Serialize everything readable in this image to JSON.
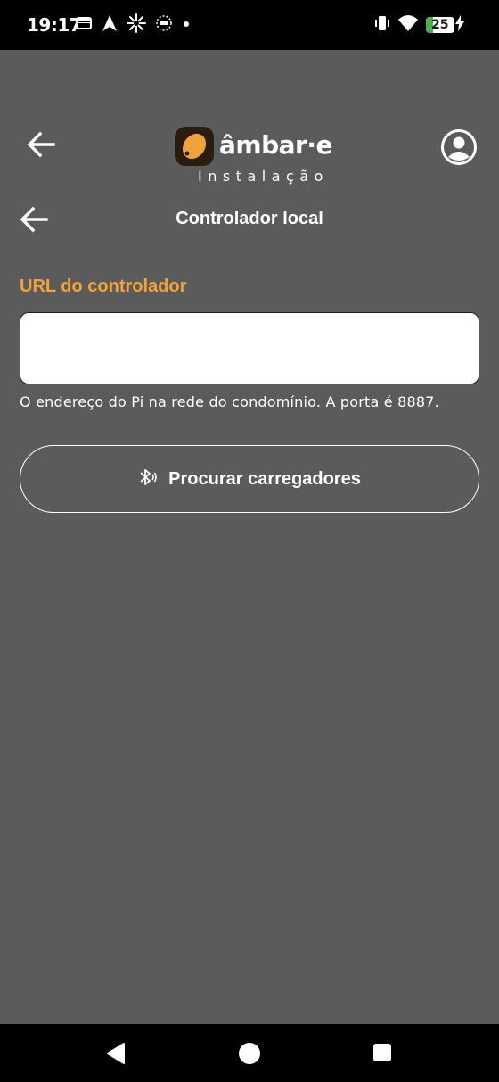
{
  "status_bar": {
    "time": "19:17",
    "battery_level": "25",
    "battery_fill_percent": 25,
    "left_icons": [
      "wallet-icon",
      "navigation-arrow-icon",
      "pinwheel-icon",
      "nfc-badge-icon",
      "dot-icon"
    ],
    "right_icons": [
      "vibrate-icon",
      "wifi-icon",
      "battery-icon",
      "charging-bolt-icon"
    ]
  },
  "app_bar": {
    "brand_name": "âmbar·e",
    "brand_subtitle": "Instalação",
    "brand_color": "#f0a33c"
  },
  "page": {
    "title": "Controlador local"
  },
  "form": {
    "url_label": "URL do controlador",
    "url_value": "",
    "helper_text": "O endereço do Pi na rede do condomínio. A porta é 8887.",
    "scan_button_label": "Procurar carregadores",
    "scan_button_icon": "bluetooth-searching-icon"
  },
  "colors": {
    "background": "#5b5b5b",
    "accent": "#f0a33c",
    "battery_green": "#4caf50"
  },
  "nav_bar": {
    "buttons": [
      "back-triangle-icon",
      "home-circle-icon",
      "recents-square-icon"
    ]
  }
}
